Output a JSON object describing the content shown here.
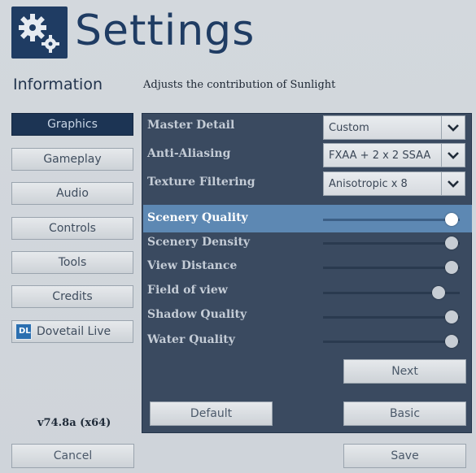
{
  "header": {
    "title": "Settings",
    "icon": "gears-icon"
  },
  "section": {
    "title": "Information",
    "description": "Adjusts the contribution of Sunlight"
  },
  "nav": {
    "items": [
      {
        "label": "Graphics",
        "active": true
      },
      {
        "label": "Gameplay"
      },
      {
        "label": "Audio"
      },
      {
        "label": "Controls"
      },
      {
        "label": "Tools"
      },
      {
        "label": "Credits"
      },
      {
        "label": "Dovetail Live",
        "icon": "dovetail-live-icon"
      }
    ]
  },
  "graphics": {
    "dropdowns": [
      {
        "label": "Master Detail",
        "value": "Custom"
      },
      {
        "label": "Anti-Aliasing",
        "value": "FXAA + 2 x 2 SSAA"
      },
      {
        "label": "Texture Filtering",
        "value": "Anisotropic x 8"
      }
    ],
    "sliders": [
      {
        "label": "Scenery Quality",
        "level": 1.0,
        "highlighted": true
      },
      {
        "label": "Scenery Density",
        "level": 1.0
      },
      {
        "label": "View Distance",
        "level": 1.0
      },
      {
        "label": "Field of view",
        "level": 0.9
      },
      {
        "label": "Shadow Quality",
        "level": 1.0
      },
      {
        "label": "Water Quality",
        "level": 1.0
      }
    ],
    "next_label": "Next",
    "default_label": "Default",
    "basic_label": "Basic"
  },
  "footer": {
    "version": "v74.8a (x64)",
    "cancel_label": "Cancel",
    "save_label": "Save"
  },
  "colors": {
    "brand": "#1f3c63",
    "panel": "#3a4a60",
    "highlight": "#5d88b3"
  }
}
